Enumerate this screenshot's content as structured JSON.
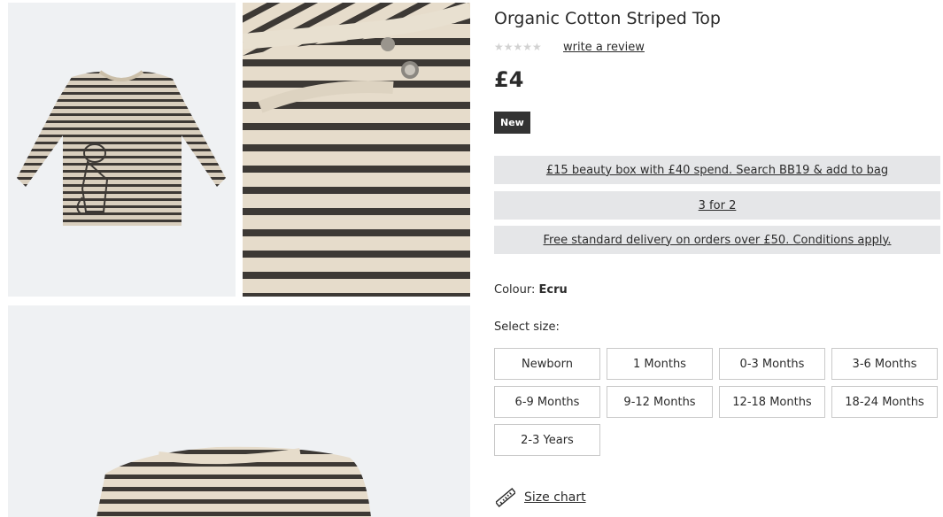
{
  "product": {
    "title": "Organic Cotton Striped Top",
    "stars": "★★★★★",
    "review_link": "write a review",
    "price": "£4",
    "badge": "New"
  },
  "promos": [
    "£15 beauty box with £40 spend. Search BB19 & add to bag",
    "3 for 2",
    "Free standard delivery on orders over £50. Conditions apply."
  ],
  "colour": {
    "label": "Colour:",
    "value": "Ecru"
  },
  "sizes": {
    "label": "Select size:",
    "options": [
      "Newborn",
      "1 Months",
      "0-3 Months",
      "3-6 Months",
      "6-9 Months",
      "9-12 Months",
      "12-18 Months",
      "18-24 Months",
      "2-3 Years"
    ]
  },
  "size_chart": {
    "label": "Size chart",
    "icon": "ruler-icon"
  },
  "colors": {
    "stripe": "#3d3935",
    "fabric": "#e6dccb",
    "tile_bg": "#eff1f3",
    "promo_bg": "#e5e6e8",
    "badge_bg": "#333333"
  }
}
